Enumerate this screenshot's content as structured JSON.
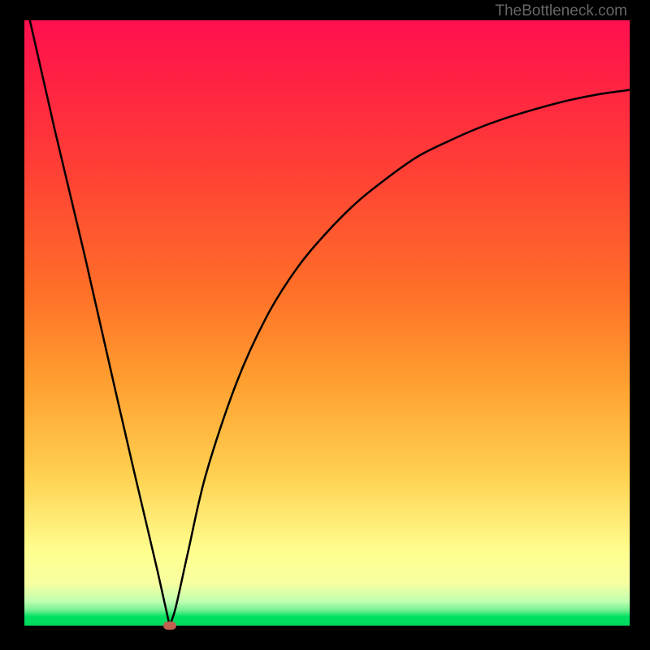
{
  "watermark": "TheBottleneck.com",
  "chart_data": {
    "type": "line",
    "title": "",
    "xlabel": "",
    "ylabel": "",
    "xlim": [
      0,
      100
    ],
    "ylim": [
      0,
      100
    ],
    "gradient_bands": [
      {
        "y_start": 0,
        "y_end": 2,
        "color_top": "#00e060",
        "color_bottom": "#00e060"
      },
      {
        "y_start": 2,
        "y_end": 4,
        "color_top": "#60f090",
        "color_bottom": "#a0ffb0"
      },
      {
        "y_start": 4,
        "y_end": 12,
        "color_top": "#a0ffb0",
        "color_bottom": "#ffffa0"
      },
      {
        "y_start": 12,
        "y_end": 55,
        "color_top": "#ffffa0",
        "color_bottom": "#ffa030"
      },
      {
        "y_start": 55,
        "y_end": 100,
        "color_top": "#ffa030",
        "color_bottom": "#ff1050"
      }
    ],
    "series": [
      {
        "name": "bottleneck-curve-left",
        "type": "line",
        "x": [
          0,
          5,
          10,
          15,
          18,
          20,
          22,
          23,
          24
        ],
        "y": [
          104,
          82,
          61,
          39,
          26,
          17.5,
          9,
          4.5,
          0
        ]
      },
      {
        "name": "bottleneck-curve-right",
        "type": "curve",
        "x": [
          24,
          25,
          27,
          30,
          35,
          40,
          45,
          50,
          55,
          60,
          65,
          70,
          75,
          80,
          85,
          90,
          95,
          100
        ],
        "y": [
          0,
          3,
          12,
          25,
          40,
          51,
          59,
          65,
          70,
          74,
          77.5,
          80,
          82.2,
          84,
          85.5,
          86.8,
          87.8,
          88.5
        ]
      }
    ],
    "marker": {
      "x": 24,
      "y": 0,
      "color": "#c06050"
    }
  }
}
